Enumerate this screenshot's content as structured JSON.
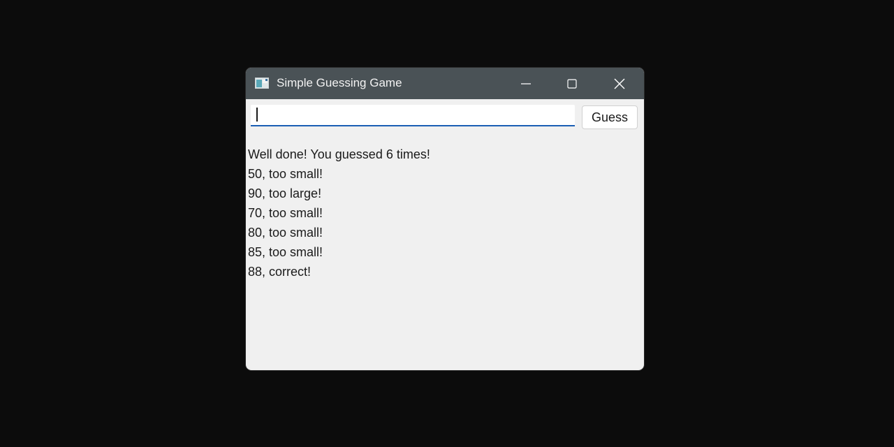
{
  "window": {
    "title": "Simple Guessing Game"
  },
  "input": {
    "value": "",
    "placeholder": ""
  },
  "button": {
    "guess_label": "Guess"
  },
  "log": [
    "Well done! You guessed 6 times!",
    "50, too small!",
    "90, too large!",
    "70, too small!",
    "80, too small!",
    "85, too small!",
    "88, correct!"
  ],
  "icons": {
    "app": "window-app-icon",
    "minimize": "minimize-icon",
    "maximize": "maximize-icon",
    "close": "close-icon"
  },
  "colors": {
    "titlebar": "#4a5256",
    "accent": "#1a5fb4",
    "background": "#f0f0f0",
    "desktop": "#0c0c0c"
  }
}
